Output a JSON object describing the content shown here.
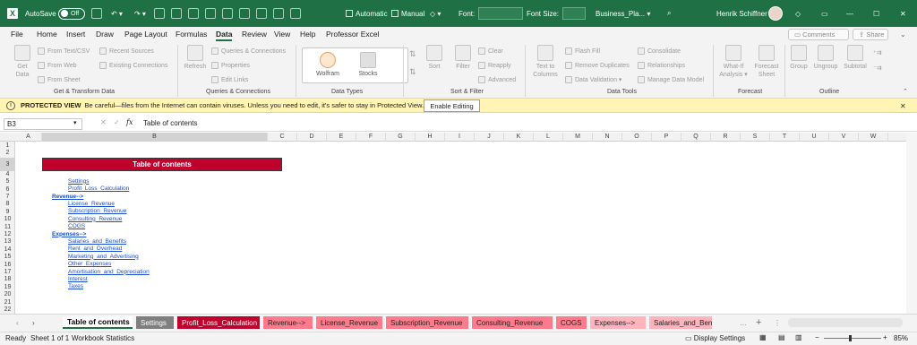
{
  "titlebar": {
    "autosave_label": "AutoSave",
    "autosave_state": "Off",
    "checkbox_automatic": "Automatic",
    "checkbox_manual": "Manual",
    "font_label": "Font:",
    "font_size_label": "Font Size:",
    "filename": "Business_Pla...",
    "user_name": "Henrik Schiffner",
    "minimize": "—",
    "maximize": "☐",
    "close": "✕"
  },
  "menu": {
    "tabs": [
      "File",
      "Home",
      "Insert",
      "Draw",
      "Page Layout",
      "Formulas",
      "Data",
      "Review",
      "View",
      "Help",
      "Professor Excel"
    ],
    "active": "Data",
    "comments_button": "Comments",
    "share_button": "Share"
  },
  "ribbon": {
    "get_data": "Get Data",
    "get_data_2": "Data",
    "from_text_csv": "From Text/CSV",
    "from_web": "From Web",
    "from_sheet": "From Sheet",
    "recent_sources": "Recent Sources",
    "existing_connections": "Existing Connections",
    "group_get_transform": "Get & Transform Data",
    "refresh_all": "Refresh",
    "refresh_all_2": "All",
    "queries_connections": "Queries & Connections",
    "properties": "Properties",
    "edit_links": "Edit Links",
    "group_queries": "Queries & Connections",
    "wolfram": "Wolfram",
    "stocks": "Stocks",
    "group_data_types": "Data Types",
    "sort": "Sort",
    "filter": "Filter",
    "clear": "Clear",
    "reapply": "Reapply",
    "advanced": "Advanced",
    "group_sort_filter": "Sort & Filter",
    "text_to_columns": "Text to",
    "text_to_columns_2": "Columns",
    "flash_fill": "Flash Fill",
    "remove_duplicates": "Remove Duplicates",
    "data_validation": "Data Validation",
    "consolidate": "Consolidate",
    "relationships": "Relationships",
    "manage_data_model": "Manage Data Model",
    "group_data_tools": "Data Tools",
    "what_if": "What-If",
    "what_if_2": "Analysis",
    "forecast_sheet": "Forecast",
    "forecast_sheet_2": "Sheet",
    "group_forecast": "Forecast",
    "group": "Group",
    "ungroup": "Ungroup",
    "subtotal": "Subtotal",
    "group_outline": "Outline"
  },
  "protected": {
    "title": "PROTECTED VIEW",
    "message": "Be careful—files from the Internet can contain viruses. Unless you need to edit, it's safer to stay in Protected View.",
    "enable_button": "Enable Editing"
  },
  "formula_bar": {
    "name_box": "B3",
    "fx": "fx",
    "content": "Table of contents"
  },
  "columns": [
    "A",
    "B",
    "C",
    "D",
    "E",
    "F",
    "G",
    "H",
    "I",
    "J",
    "K",
    "L",
    "M",
    "N",
    "O",
    "P",
    "Q",
    "R",
    "S",
    "T",
    "U",
    "V",
    "W"
  ],
  "rows": [
    "1",
    "2",
    "3",
    "4",
    "5",
    "6",
    "7",
    "8",
    "9",
    "10",
    "11",
    "12",
    "13",
    "14",
    "15",
    "16",
    "17",
    "18",
    "19",
    "20",
    "21",
    "22"
  ],
  "sheet": {
    "toc_title": "Table of contents",
    "links": [
      {
        "text": "Settings",
        "indent": 1,
        "row": 5
      },
      {
        "text": "Profit_Loss_Calculation",
        "indent": 1,
        "row": 6
      },
      {
        "text": "Revenue-->",
        "indent": 0,
        "row": 7
      },
      {
        "text": "License_Revenue",
        "indent": 1,
        "row": 8
      },
      {
        "text": "Subscription_Revenue",
        "indent": 1,
        "row": 9
      },
      {
        "text": "Consulting_Revenue",
        "indent": 1,
        "row": 10
      },
      {
        "text": "COGS",
        "indent": 1,
        "row": 11
      },
      {
        "text": "Expenses-->",
        "indent": 0,
        "row": 12
      },
      {
        "text": "Salaries_and_Benefits",
        "indent": 1,
        "row": 13
      },
      {
        "text": "Rent_and_Overhead",
        "indent": 1,
        "row": 14
      },
      {
        "text": "Marketing_and_Advertising",
        "indent": 1,
        "row": 15
      },
      {
        "text": "Other_Expenses",
        "indent": 1,
        "row": 16
      },
      {
        "text": "Amortisation_and_Depreciation",
        "indent": 1,
        "row": 17
      },
      {
        "text": "Interest",
        "indent": 1,
        "row": 18
      },
      {
        "text": "Taxes",
        "indent": 1,
        "row": 19
      }
    ]
  },
  "sheet_tabs": [
    {
      "label": "Table of contents",
      "bg": "#ffffff",
      "fg": "#000000",
      "active": true
    },
    {
      "label": "Settings",
      "bg": "#7f7f7f",
      "fg": "#ffffff"
    },
    {
      "label": "Profit_Loss_Calculation",
      "bg": "#c0002d",
      "fg": "#ffffff"
    },
    {
      "label": "Revenue-->",
      "bg": "#ff7a8a",
      "fg": "#222222"
    },
    {
      "label": "License_Revenue",
      "bg": "#ff7a8a",
      "fg": "#222222"
    },
    {
      "label": "Subscription_Revenue",
      "bg": "#ff7a8a",
      "fg": "#222222"
    },
    {
      "label": "Consulting_Revenue",
      "bg": "#ff7a8a",
      "fg": "#222222"
    },
    {
      "label": "COGS",
      "bg": "#ff7a8a",
      "fg": "#222222"
    },
    {
      "label": "Expenses-->",
      "bg": "#ffb3bd",
      "fg": "#222222"
    },
    {
      "label": "Salaries_and_Benefi",
      "bg": "#ffb3bd",
      "fg": "#222222"
    }
  ],
  "status": {
    "ready": "Ready",
    "sheet_of": "Sheet 1 of 1",
    "workbook_stats": "Workbook Statistics",
    "display_settings": "Display Settings",
    "zoom": "85%"
  }
}
